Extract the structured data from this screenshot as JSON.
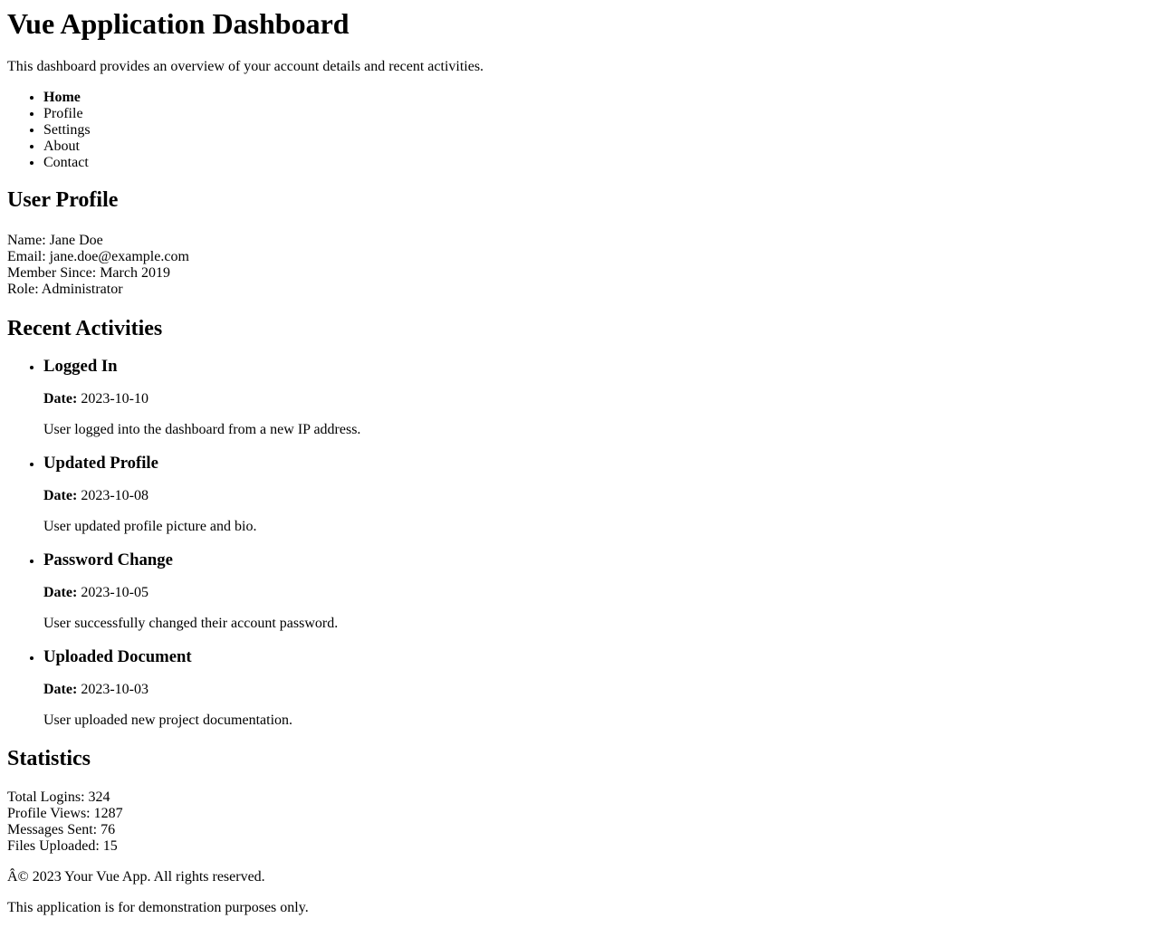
{
  "header": {
    "title": "Vue Application Dashboard",
    "intro": "This dashboard provides an overview of your account details and recent activities."
  },
  "nav": {
    "items": [
      {
        "label": "Home",
        "active": true
      },
      {
        "label": "Profile",
        "active": false
      },
      {
        "label": "Settings",
        "active": false
      },
      {
        "label": "About",
        "active": false
      },
      {
        "label": "Contact",
        "active": false
      }
    ]
  },
  "profile": {
    "title": "User Profile",
    "name": "Name: Jane Doe",
    "email": "Email: jane.doe@example.com",
    "member_since": "Member Since: March 2019",
    "role": "Role: Administrator"
  },
  "activities": {
    "title": "Recent Activities",
    "date_label": "Date:",
    "items": [
      {
        "title": "Logged In",
        "date": "2023-10-10",
        "description": "User logged into the dashboard from a new IP address."
      },
      {
        "title": "Updated Profile",
        "date": "2023-10-08",
        "description": "User updated profile picture and bio."
      },
      {
        "title": "Password Change",
        "date": "2023-10-05",
        "description": "User successfully changed their account password."
      },
      {
        "title": "Uploaded Document",
        "date": "2023-10-03",
        "description": "User uploaded new project documentation."
      }
    ]
  },
  "statistics": {
    "title": "Statistics",
    "total_logins": "Total Logins: 324",
    "profile_views": "Profile Views: 1287",
    "messages_sent": "Messages Sent: 76",
    "files_uploaded": "Files Uploaded: 15"
  },
  "footer": {
    "copyright": "Â© 2023 Your Vue App. All rights reserved.",
    "note": "This application is for demonstration purposes only."
  }
}
